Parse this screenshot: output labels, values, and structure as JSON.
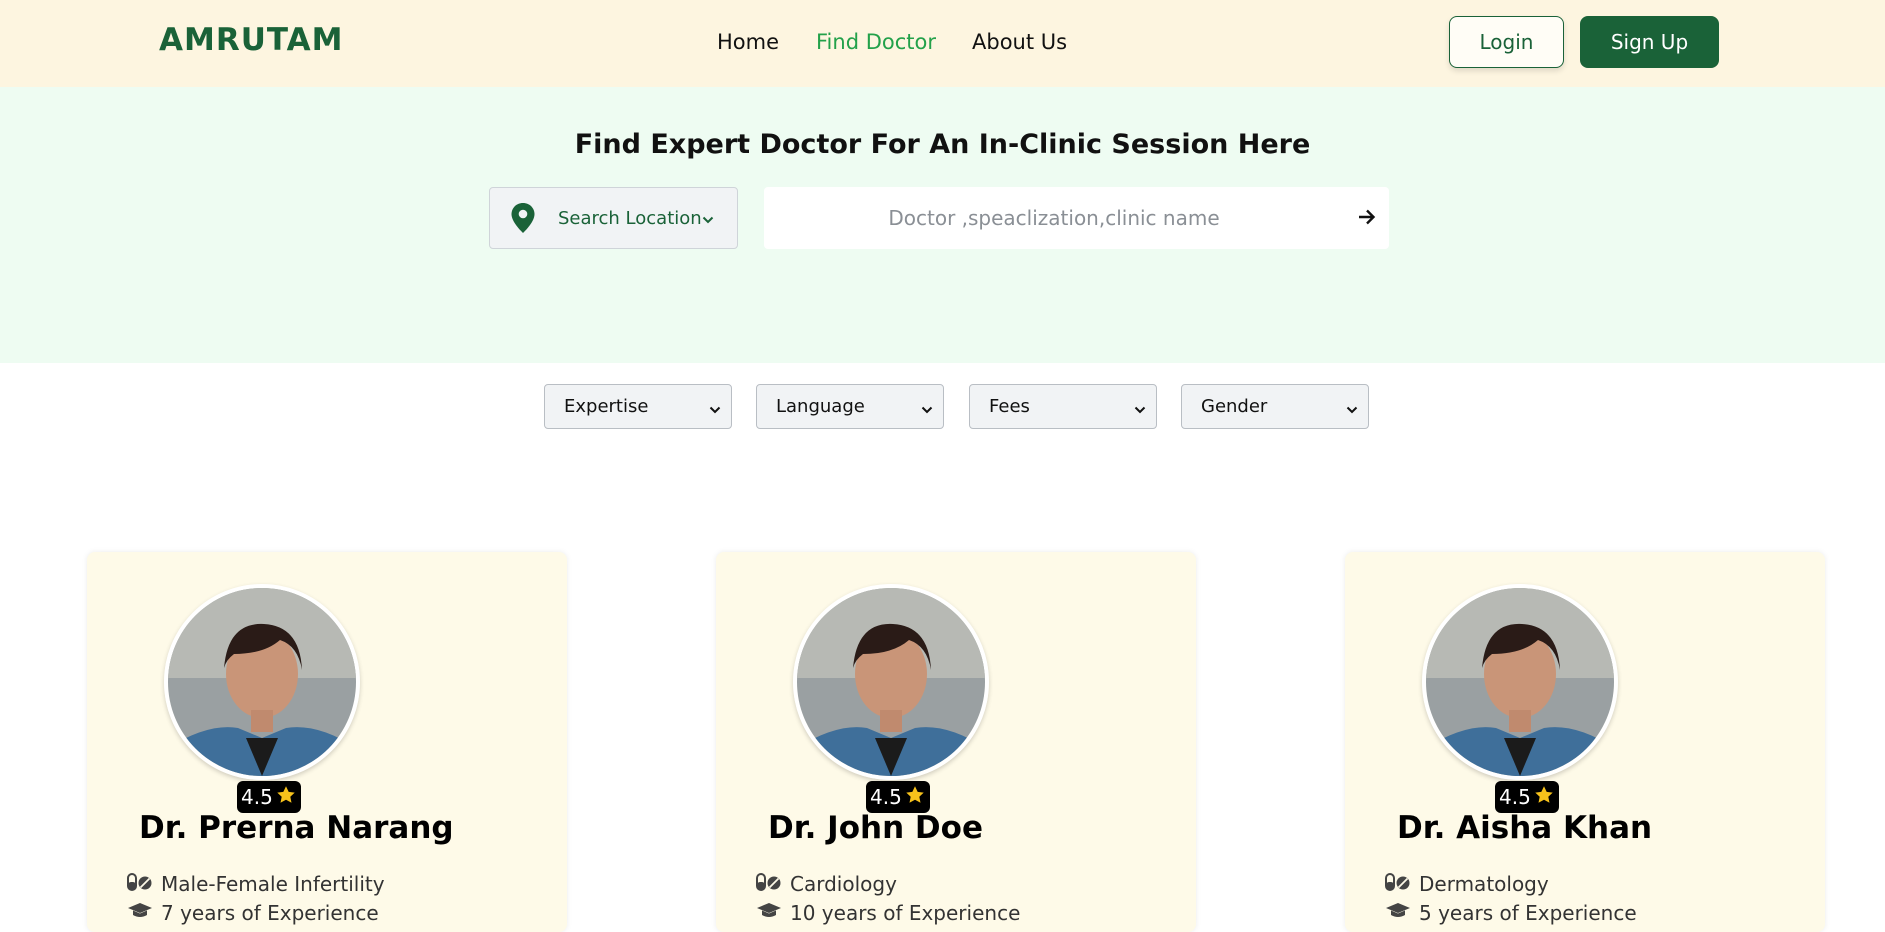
{
  "header": {
    "logo": "AMRUTAM",
    "nav": [
      {
        "label": "Home"
      },
      {
        "label": "Find Doctor",
        "active": true
      },
      {
        "label": "About Us"
      }
    ],
    "login_label": "Login",
    "signup_label": "Sign Up"
  },
  "hero": {
    "title": "Find Expert Doctor For An In-Clinic Session Here",
    "location_label": "Search Location",
    "search_placeholder": "Doctor ,speaclization,clinic name"
  },
  "filters": [
    {
      "label": "Expertise"
    },
    {
      "label": "Language"
    },
    {
      "label": "Fees"
    },
    {
      "label": "Gender"
    }
  ],
  "doctors": [
    {
      "name": "Dr. Prerna Narang",
      "rating": "4.5",
      "specialization": "Male-Female Infertility",
      "experience": "7 years of Experience"
    },
    {
      "name": "Dr. John Doe",
      "rating": "4.5",
      "specialization": "Cardiology",
      "experience": "10 years of Experience"
    },
    {
      "name": "Dr. Aisha Khan",
      "rating": "4.5",
      "specialization": "Dermatology",
      "experience": "5 years of Experience"
    }
  ],
  "colors": {
    "brand_green": "#1a6238",
    "active_link": "#23a14a",
    "header_bg": "#fdf5e0",
    "hero_bg": "#eefcf2",
    "card_bg": "#fefae8",
    "star": "#f7c21b"
  }
}
